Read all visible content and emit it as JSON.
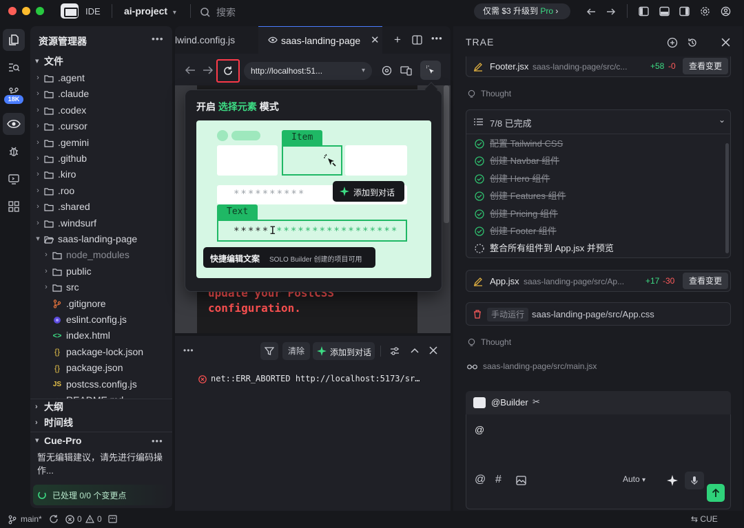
{
  "titlebar": {
    "ide_label": "IDE",
    "project_name": "ai-project",
    "search_placeholder": "搜索",
    "upgrade_prefix": "仅需 $3 升级到 ",
    "upgrade_pro": "Pro",
    "upgrade_suffix": " ›"
  },
  "activity": {
    "badge": "18K"
  },
  "explorer": {
    "title": "资源管理器",
    "files_section": "文件",
    "items": [
      {
        "label": ".agent",
        "type": "folder",
        "depth": 0,
        "open": false
      },
      {
        "label": ".claude",
        "type": "folder",
        "depth": 0,
        "open": false
      },
      {
        "label": ".codex",
        "type": "folder",
        "depth": 0,
        "open": false
      },
      {
        "label": ".cursor",
        "type": "folder",
        "depth": 0,
        "open": false
      },
      {
        "label": ".gemini",
        "type": "folder",
        "depth": 0,
        "open": false
      },
      {
        "label": ".github",
        "type": "folder",
        "depth": 0,
        "open": false
      },
      {
        "label": ".kiro",
        "type": "folder",
        "depth": 0,
        "open": false
      },
      {
        "label": ".roo",
        "type": "folder",
        "depth": 0,
        "open": false
      },
      {
        "label": ".shared",
        "type": "folder",
        "depth": 0,
        "open": false
      },
      {
        "label": ".windsurf",
        "type": "folder",
        "depth": 0,
        "open": false
      },
      {
        "label": "saas-landing-page",
        "type": "folder",
        "depth": 0,
        "open": true
      },
      {
        "label": "node_modules",
        "type": "folder",
        "depth": 1,
        "open": false,
        "dim": true
      },
      {
        "label": "public",
        "type": "folder",
        "depth": 1,
        "open": false
      },
      {
        "label": "src",
        "type": "folder",
        "depth": 1,
        "open": false
      },
      {
        "label": ".gitignore",
        "type": "git",
        "depth": 1
      },
      {
        "label": "eslint.config.js",
        "type": "eslint",
        "depth": 1
      },
      {
        "label": "index.html",
        "type": "html",
        "depth": 1
      },
      {
        "label": "package-lock.json",
        "type": "json",
        "depth": 1
      },
      {
        "label": "package.json",
        "type": "json",
        "depth": 1
      },
      {
        "label": "postcss.config.js",
        "type": "js",
        "depth": 1
      },
      {
        "label": "README.md",
        "type": "md",
        "depth": 1
      }
    ],
    "outline_section": "大纲",
    "timeline_section": "时间线",
    "cue_pro_title": "Cue-Pro",
    "cue_pro_message": "暂无编辑建议，请先进行编码操作...",
    "cue_status": "已处理 0/0 个变更点"
  },
  "editor": {
    "tabs": [
      {
        "label": "lwind.config.js",
        "active": false
      },
      {
        "label": "saas-landing-page",
        "active": true
      }
    ],
    "url": "http://localhost:51...",
    "code_line1": "update your PostCSS",
    "code_line2": "configuration."
  },
  "popover": {
    "title_prefix": "开启 ",
    "title_highlight": "选择元素",
    "title_suffix": " 模式",
    "item_tag": "Item",
    "text_tag": "Text",
    "stars_row": "**********",
    "stars_field_left": "*****",
    "stars_field_right": "*****************",
    "add_to_chat": "添加到对话",
    "quick_edit": "快捷编辑文案",
    "quick_edit_note": "SOLO Builder 创建的项目可用"
  },
  "console": {
    "clear_label": "清除",
    "add_to_chat": "添加到对话",
    "error_text": "net::ERR_ABORTED http://localhost:5173/sr…"
  },
  "assistant": {
    "title": "TRAE",
    "footer_file": "Footer.jsx",
    "footer_path": "saas-landing-page/src/c...",
    "footer_add": "+58",
    "footer_del": "-0",
    "view_changes": "查看变更",
    "thought1": "Thought",
    "todo_summary": "7/8 已完成",
    "todos": [
      {
        "label": "配置 Tailwind CSS",
        "done": true
      },
      {
        "label": "创建 Navbar 组件",
        "done": true
      },
      {
        "label": "创建 Hero 组件",
        "done": true
      },
      {
        "label": "创建 Features 组件",
        "done": true
      },
      {
        "label": "创建 Pricing 组件",
        "done": true
      },
      {
        "label": "创建 Footer 组件",
        "done": true
      },
      {
        "label": "整合所有组件到 App.jsx 并预览",
        "done": false
      }
    ],
    "app_file": "App.jsx",
    "app_path": "saas-landing-page/src/Ap...",
    "app_add": "+17",
    "app_del": "-30",
    "manual_run": "手动运行",
    "manual_path": "saas-landing-page/src/App.css",
    "thought2": "Thought",
    "read_path": "saas-landing-page/src/main.jsx",
    "builder_label": "@Builder",
    "input_value": "@",
    "model": "Auto"
  },
  "statusbar": {
    "branch": "main*",
    "errors": "0",
    "warnings": "0",
    "cue": "CUE"
  }
}
